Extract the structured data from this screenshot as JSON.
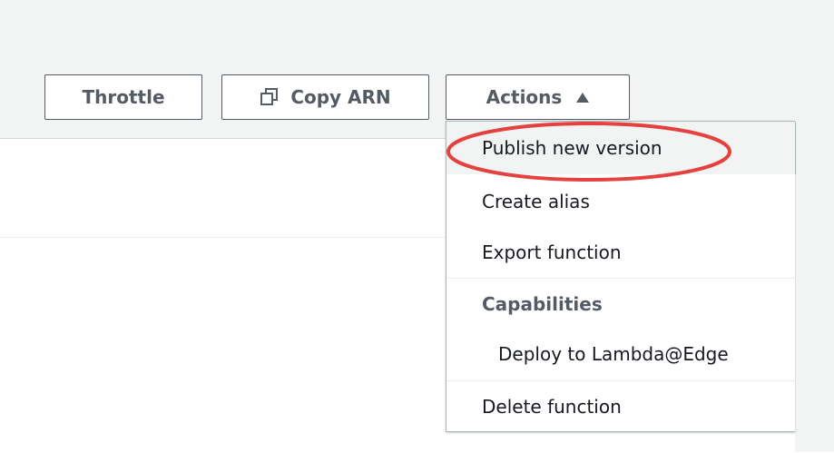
{
  "toolbar": {
    "throttle_label": "Throttle",
    "copy_arn_label": "Copy ARN",
    "actions_label": "Actions"
  },
  "icons": {
    "copy": "copy-icon",
    "caret": "caret-up-icon"
  },
  "actions_menu": {
    "items": [
      {
        "label": "Publish new version"
      },
      {
        "label": "Create alias"
      },
      {
        "label": "Export function"
      },
      {
        "label": "Capabilities"
      },
      {
        "label": "Deploy to Lambda@Edge"
      },
      {
        "label": "Delete function"
      }
    ]
  },
  "colors": {
    "annotation": "#e4423f",
    "button_border": "#545b64",
    "highlight_bg": "#f2f3f3"
  }
}
